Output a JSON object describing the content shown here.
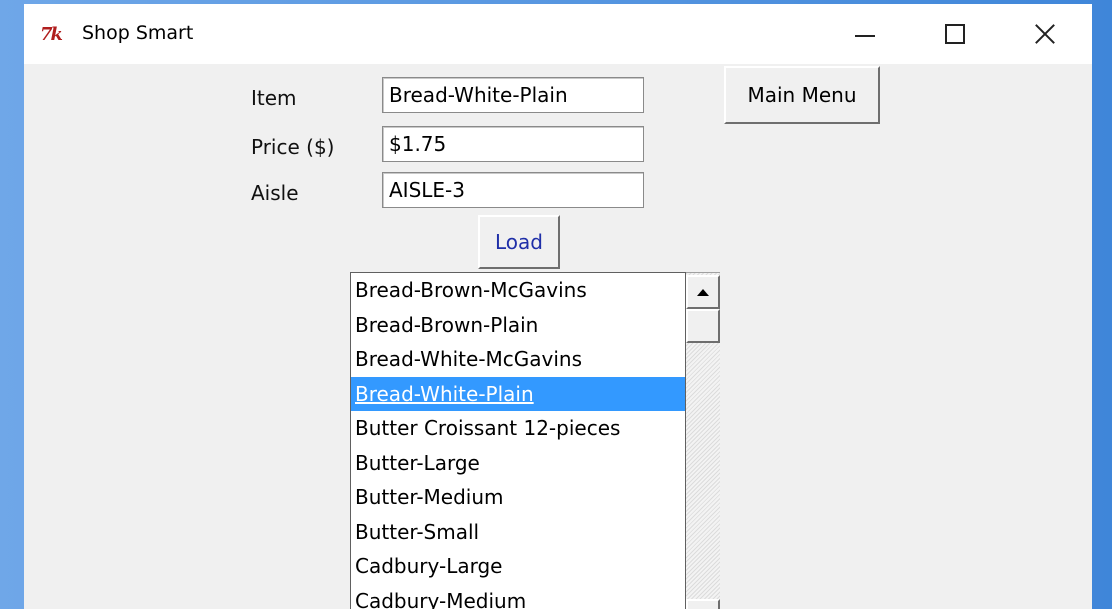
{
  "window": {
    "title": "Shop Smart",
    "icon": "tk-feather-icon",
    "icon_glyph": "7k"
  },
  "form": {
    "item_label": "Item",
    "item_value": "Bread-White-Plain",
    "price_label": "Price ($)",
    "price_value": "$1.75",
    "aisle_label": "Aisle",
    "aisle_value": "AISLE-3"
  },
  "buttons": {
    "main_menu": "Main Menu",
    "load": "Load"
  },
  "list": {
    "items": [
      "Bread-Brown-McGavins",
      "Bread-Brown-Plain",
      "Bread-White-McGavins",
      "Bread-White-Plain",
      "Butter Croissant 12-pieces",
      "Butter-Large",
      "Butter-Medium",
      "Butter-Small",
      "Cadbury-Large",
      "Cadbury-Medium"
    ],
    "selected_index": 3
  },
  "colors": {
    "selection": "#3399ff",
    "load_text": "#1f2fa8",
    "icon": "#b01e1e"
  }
}
